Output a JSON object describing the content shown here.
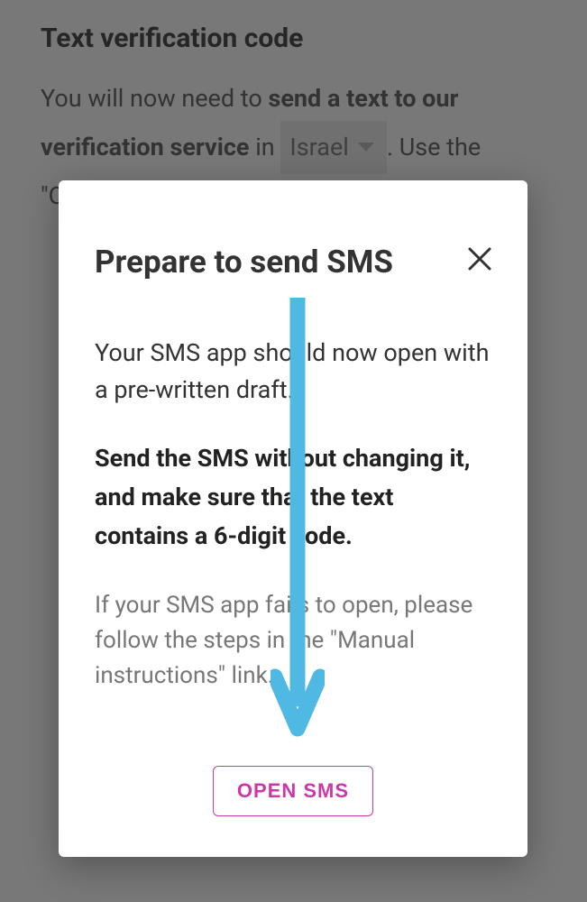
{
  "page": {
    "title": "Text verification code",
    "desc_prefix": "You will now need to ",
    "desc_bold": "send a text to our verification service",
    "desc_in": " in ",
    "country": "Israel",
    "desc_suffix": ". Use the \"Open SMS\" button to automatically open a t"
  },
  "modal": {
    "title": "Prepare to send SMS",
    "text1": "Your SMS app should now open with a pre-written draft.",
    "text_bold": "Send the SMS without changing it, and make sure that the text contains a 6-digit code.",
    "hint": "If your SMS app fails to open, please follow the steps in the \"Manual instructions\" link.",
    "button_label": "OPEN SMS"
  }
}
